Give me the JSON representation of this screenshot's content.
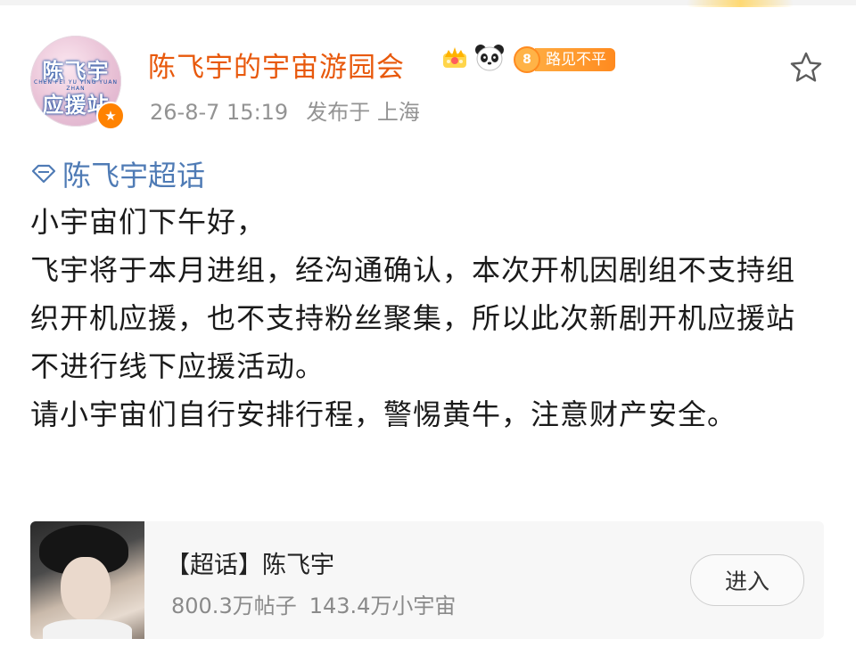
{
  "post": {
    "author": {
      "name": "陈飞宇的宇宙游园会",
      "avatar_text_line1": "陈飞宇",
      "avatar_text_line2": "应援站",
      "avatar_text_small": "CHEN FEI YU YING YUAN ZHAN",
      "verified_icon": "verified-v-icon",
      "level_number": "8",
      "level_title": "路见不平",
      "name_color": "#e8590c"
    },
    "meta": {
      "date": "26-8-7 15:19",
      "location": "发布于 上海"
    },
    "topic_tag": "陈飞宇超话",
    "topic_color": "#4f7bb5",
    "paragraphs": [
      "小宇宙们下午好，",
      "飞宇将于本月进组，经沟通确认，本次开机因剧组不支持组织开机应援，也不支持粉丝聚集，所以此次新剧开机应援站不进行线下应援活动。",
      "请小宇宙们自行安排行程，警惕黄牛，注意财产安全。"
    ]
  },
  "card": {
    "title": "【超话】陈飞宇",
    "posts_count": "800.3万帖子",
    "members_count": "143.4万小宇宙",
    "enter_label": "进入"
  }
}
